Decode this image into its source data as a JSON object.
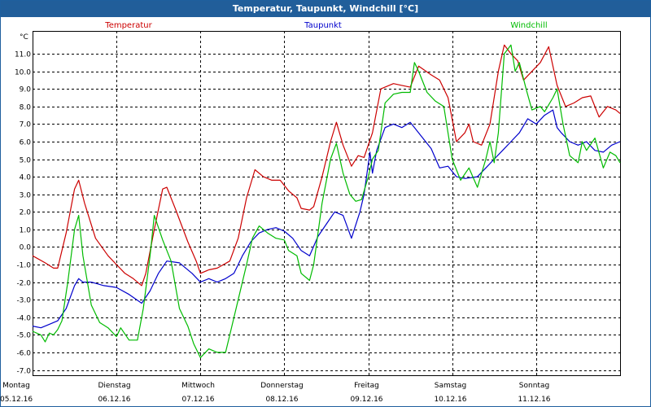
{
  "window": {
    "title": "Temperatur, Taupunkt, Windchill [°C]"
  },
  "chart_data": {
    "type": "line",
    "title": "Temperatur, Taupunkt, Windchill [°C]",
    "ylabel": "°C",
    "ylim": [
      -7.3,
      12.3
    ],
    "xlim": [
      0,
      7
    ],
    "y_ticks": [
      11,
      10,
      9,
      8,
      7,
      6,
      5,
      4,
      3,
      2,
      1,
      0,
      -1,
      -2,
      -3,
      -4,
      -5,
      -6,
      -7
    ],
    "y_tick_labels": [
      "11.0",
      "10.0",
      "9.0",
      "8.0",
      "7.0",
      "6.0",
      "5.0",
      "4.0",
      "3.0",
      "2.0",
      "1.0",
      "0.0",
      "-1.0",
      "-2.0",
      "-3.0",
      "-4.0",
      "-5.0",
      "-6.0",
      "-7.0"
    ],
    "x_ticks": [
      0,
      1,
      2,
      3,
      4,
      5,
      6
    ],
    "x_tick_days": [
      "Montag",
      "Dienstag",
      "Mittwoch",
      "Donnerstag",
      "Freitag",
      "Samstag",
      "Sonntag"
    ],
    "x_tick_dates": [
      "05.12.16",
      "06.12.16",
      "07.12.16",
      "08.12.16",
      "09.12.16",
      "10.12.16",
      "11.12.16"
    ],
    "grid": true,
    "legend_position": "top",
    "series": [
      {
        "name": "Temperatur",
        "color": "#cc0000",
        "points": [
          [
            0,
            -0.5
          ],
          [
            0.15,
            -0.9
          ],
          [
            0.25,
            -1.2
          ],
          [
            0.3,
            -1.2
          ],
          [
            0.4,
            0.8
          ],
          [
            0.5,
            3.3
          ],
          [
            0.55,
            3.8
          ],
          [
            0.62,
            2.5
          ],
          [
            0.75,
            0.5
          ],
          [
            0.9,
            -0.5
          ],
          [
            1,
            -1
          ],
          [
            1.1,
            -1.5
          ],
          [
            1.2,
            -1.8
          ],
          [
            1.3,
            -2.2
          ],
          [
            1.35,
            -1.5
          ],
          [
            1.45,
            1
          ],
          [
            1.55,
            3.3
          ],
          [
            1.6,
            3.4
          ],
          [
            1.7,
            2.2
          ],
          [
            1.85,
            0.3
          ],
          [
            1.95,
            -0.8
          ],
          [
            2,
            -1.5
          ],
          [
            2.1,
            -1.3
          ],
          [
            2.2,
            -1.2
          ],
          [
            2.35,
            -0.8
          ],
          [
            2.45,
            0.5
          ],
          [
            2.55,
            2.8
          ],
          [
            2.65,
            4.4
          ],
          [
            2.75,
            4
          ],
          [
            2.85,
            3.8
          ],
          [
            2.95,
            3.8
          ],
          [
            3.05,
            3.2
          ],
          [
            3.15,
            2.8
          ],
          [
            3.2,
            2.2
          ],
          [
            3.3,
            2.1
          ],
          [
            3.35,
            2.3
          ],
          [
            3.45,
            4
          ],
          [
            3.55,
            6
          ],
          [
            3.62,
            7.1
          ],
          [
            3.7,
            5.8
          ],
          [
            3.8,
            4.6
          ],
          [
            3.88,
            5.2
          ],
          [
            3.95,
            5.1
          ],
          [
            4.05,
            6.5
          ],
          [
            4.15,
            9
          ],
          [
            4.3,
            9.3
          ],
          [
            4.4,
            9.2
          ],
          [
            4.5,
            9.1
          ],
          [
            4.6,
            10.3
          ],
          [
            4.75,
            9.8
          ],
          [
            4.85,
            9.5
          ],
          [
            4.95,
            8.5
          ],
          [
            5.05,
            6
          ],
          [
            5.15,
            6.5
          ],
          [
            5.2,
            7
          ],
          [
            5.25,
            6
          ],
          [
            5.35,
            5.8
          ],
          [
            5.45,
            7
          ],
          [
            5.55,
            10
          ],
          [
            5.62,
            11.5
          ],
          [
            5.7,
            11
          ],
          [
            5.78,
            10.6
          ],
          [
            5.85,
            9.5
          ],
          [
            5.95,
            10
          ],
          [
            6.05,
            10.5
          ],
          [
            6.15,
            11.4
          ],
          [
            6.25,
            9.2
          ],
          [
            6.35,
            8
          ],
          [
            6.45,
            8.2
          ],
          [
            6.55,
            8.5
          ],
          [
            6.65,
            8.6
          ],
          [
            6.75,
            7.4
          ],
          [
            6.85,
            8
          ],
          [
            6.95,
            7.8
          ],
          [
            7,
            7.6
          ]
        ]
      },
      {
        "name": "Taupunkt",
        "color": "#0000cc",
        "points": [
          [
            0,
            -4.5
          ],
          [
            0.1,
            -4.6
          ],
          [
            0.2,
            -4.4
          ],
          [
            0.3,
            -4.2
          ],
          [
            0.4,
            -3.5
          ],
          [
            0.5,
            -2.2
          ],
          [
            0.55,
            -1.8
          ],
          [
            0.6,
            -2
          ],
          [
            0.7,
            -2
          ],
          [
            0.85,
            -2.2
          ],
          [
            1,
            -2.3
          ],
          [
            1.15,
            -2.7
          ],
          [
            1.3,
            -3.2
          ],
          [
            1.4,
            -2.5
          ],
          [
            1.5,
            -1.5
          ],
          [
            1.6,
            -0.8
          ],
          [
            1.75,
            -0.9
          ],
          [
            1.9,
            -1.5
          ],
          [
            2,
            -2
          ],
          [
            2.1,
            -1.8
          ],
          [
            2.2,
            -2
          ],
          [
            2.3,
            -1.8
          ],
          [
            2.4,
            -1.5
          ],
          [
            2.5,
            -0.5
          ],
          [
            2.6,
            0.3
          ],
          [
            2.7,
            0.8
          ],
          [
            2.8,
            1
          ],
          [
            2.9,
            1.1
          ],
          [
            3,
            0.9
          ],
          [
            3.1,
            0.5
          ],
          [
            3.2,
            -0.2
          ],
          [
            3.3,
            -0.5
          ],
          [
            3.4,
            0.6
          ],
          [
            3.5,
            1.3
          ],
          [
            3.6,
            2
          ],
          [
            3.7,
            1.8
          ],
          [
            3.8,
            0.5
          ],
          [
            3.9,
            2
          ],
          [
            3.95,
            3
          ],
          [
            4.02,
            5.4
          ],
          [
            4.05,
            4.2
          ],
          [
            4.1,
            5.5
          ],
          [
            4.2,
            6.8
          ],
          [
            4.3,
            7
          ],
          [
            4.4,
            6.8
          ],
          [
            4.5,
            7.1
          ],
          [
            4.6,
            6.5
          ],
          [
            4.75,
            5.6
          ],
          [
            4.85,
            4.5
          ],
          [
            4.95,
            4.6
          ],
          [
            5.05,
            4
          ],
          [
            5.15,
            3.9
          ],
          [
            5.3,
            4
          ],
          [
            5.4,
            4.5
          ],
          [
            5.5,
            5
          ],
          [
            5.6,
            5.5
          ],
          [
            5.7,
            6
          ],
          [
            5.8,
            6.5
          ],
          [
            5.9,
            7.3
          ],
          [
            6,
            7
          ],
          [
            6.1,
            7.5
          ],
          [
            6.2,
            7.8
          ],
          [
            6.25,
            6.8
          ],
          [
            6.3,
            6.5
          ],
          [
            6.4,
            6
          ],
          [
            6.5,
            5.8
          ],
          [
            6.6,
            6
          ],
          [
            6.7,
            5.5
          ],
          [
            6.8,
            5.4
          ],
          [
            6.9,
            5.8
          ],
          [
            7,
            6
          ]
        ]
      },
      {
        "name": "Windchill",
        "color": "#00bb00",
        "points": [
          [
            0,
            -4.8
          ],
          [
            0.1,
            -5
          ],
          [
            0.15,
            -5.4
          ],
          [
            0.2,
            -4.9
          ],
          [
            0.25,
            -5
          ],
          [
            0.3,
            -4.7
          ],
          [
            0.35,
            -4.2
          ],
          [
            0.42,
            -2
          ],
          [
            0.5,
            1
          ],
          [
            0.55,
            1.8
          ],
          [
            0.6,
            -0.5
          ],
          [
            0.7,
            -3.3
          ],
          [
            0.8,
            -4.3
          ],
          [
            0.9,
            -4.6
          ],
          [
            1,
            -5.1
          ],
          [
            1.05,
            -4.6
          ],
          [
            1.15,
            -5.3
          ],
          [
            1.25,
            -5.3
          ],
          [
            1.32,
            -3.5
          ],
          [
            1.4,
            -0.5
          ],
          [
            1.45,
            1.8
          ],
          [
            1.55,
            0.4
          ],
          [
            1.65,
            -0.8
          ],
          [
            1.75,
            -3.5
          ],
          [
            1.85,
            -4.5
          ],
          [
            1.92,
            -5.5
          ],
          [
            2,
            -6.3
          ],
          [
            2.1,
            -5.8
          ],
          [
            2.2,
            -6
          ],
          [
            2.3,
            -6
          ],
          [
            2.35,
            -5
          ],
          [
            2.45,
            -3
          ],
          [
            2.55,
            -1
          ],
          [
            2.62,
            0.5
          ],
          [
            2.7,
            1.2
          ],
          [
            2.8,
            0.8
          ],
          [
            2.9,
            0.5
          ],
          [
            3,
            0.4
          ],
          [
            3.05,
            -0.2
          ],
          [
            3.15,
            -0.5
          ],
          [
            3.2,
            -1.5
          ],
          [
            3.3,
            -1.9
          ],
          [
            3.35,
            -1
          ],
          [
            3.45,
            2.5
          ],
          [
            3.55,
            5
          ],
          [
            3.62,
            5.9
          ],
          [
            3.7,
            4.2
          ],
          [
            3.78,
            3
          ],
          [
            3.85,
            2.6
          ],
          [
            3.92,
            2.7
          ],
          [
            4,
            4
          ],
          [
            4.05,
            5
          ],
          [
            4.12,
            5.5
          ],
          [
            4.2,
            8.2
          ],
          [
            4.3,
            8.7
          ],
          [
            4.4,
            8.8
          ],
          [
            4.5,
            8.8
          ],
          [
            4.55,
            10.5
          ],
          [
            4.6,
            10
          ],
          [
            4.7,
            8.8
          ],
          [
            4.8,
            8.3
          ],
          [
            4.9,
            8
          ],
          [
            5,
            5
          ],
          [
            5.1,
            3.8
          ],
          [
            5.2,
            4.5
          ],
          [
            5.3,
            3.4
          ],
          [
            5.4,
            5
          ],
          [
            5.45,
            6
          ],
          [
            5.5,
            4.8
          ],
          [
            5.55,
            6.5
          ],
          [
            5.62,
            11
          ],
          [
            5.7,
            11.5
          ],
          [
            5.75,
            10
          ],
          [
            5.8,
            10.5
          ],
          [
            5.88,
            9
          ],
          [
            5.95,
            7.8
          ],
          [
            6.05,
            8
          ],
          [
            6.1,
            7.7
          ],
          [
            6.2,
            8.5
          ],
          [
            6.25,
            9
          ],
          [
            6.32,
            7
          ],
          [
            6.4,
            5.2
          ],
          [
            6.5,
            4.8
          ],
          [
            6.55,
            6
          ],
          [
            6.6,
            5.5
          ],
          [
            6.7,
            6.2
          ],
          [
            6.8,
            4.5
          ],
          [
            6.88,
            5.4
          ],
          [
            6.95,
            5.2
          ],
          [
            7,
            4.8
          ]
        ]
      }
    ]
  }
}
